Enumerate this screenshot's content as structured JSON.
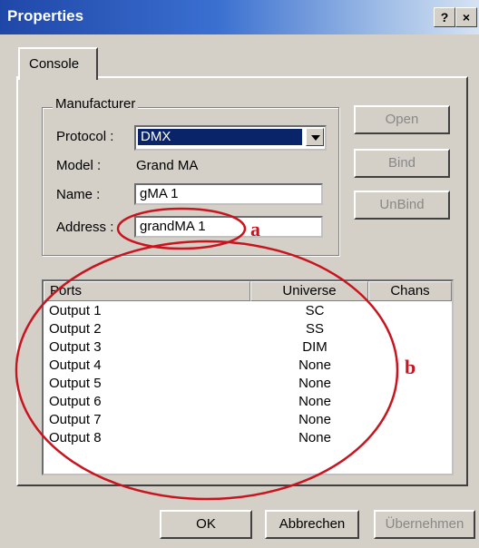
{
  "window": {
    "title": "Properties",
    "help_button": "?",
    "close_button": "×"
  },
  "tabs": [
    {
      "label": "Console"
    }
  ],
  "manufacturer": {
    "group_label": "Manufacturer",
    "protocol_label": "Protocol :",
    "protocol_value": "DMX",
    "model_label": "Model :",
    "model_value": "Grand MA",
    "name_label": "Name :",
    "name_value": "gMA 1",
    "address_label": "Address :",
    "address_value": "grandMA 1"
  },
  "side_buttons": {
    "open": "Open",
    "bind": "Bind",
    "unbind": "UnBind"
  },
  "ports_table": {
    "columns": [
      "Ports",
      "Universe",
      "Chans"
    ],
    "rows": [
      {
        "port": "Output 1",
        "universe": "SC"
      },
      {
        "port": "Output 2",
        "universe": "SS"
      },
      {
        "port": "Output 3",
        "universe": "DIM"
      },
      {
        "port": "Output 4",
        "universe": "None"
      },
      {
        "port": "Output 5",
        "universe": "None"
      },
      {
        "port": "Output 6",
        "universe": "None"
      },
      {
        "port": "Output 7",
        "universe": "None"
      },
      {
        "port": "Output 8",
        "universe": "None"
      }
    ]
  },
  "footer_buttons": {
    "ok": "OK",
    "cancel": "Abbrechen",
    "apply": "Übernehmen"
  },
  "annotations": {
    "a": "a",
    "b": "b",
    "color": "#c8141e"
  }
}
